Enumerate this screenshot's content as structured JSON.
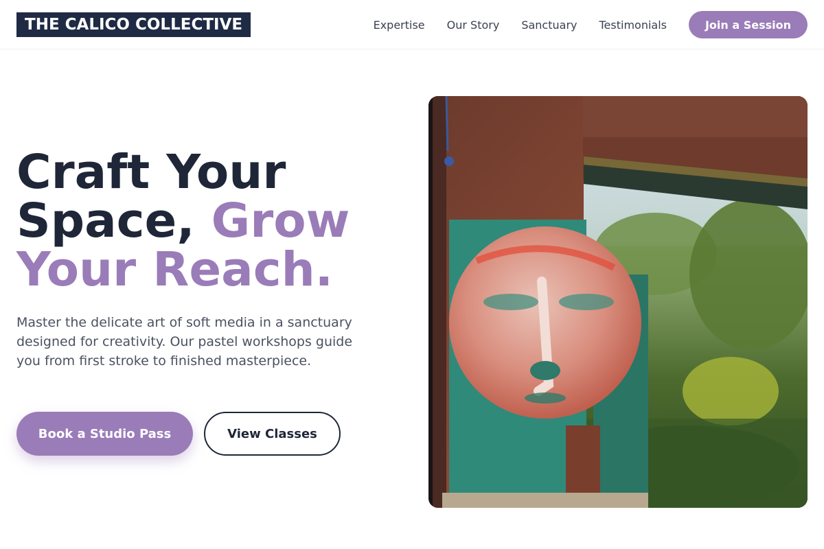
{
  "brand": {
    "logo_text": "THE CALICO COLLECTIVE"
  },
  "nav": {
    "links": [
      "Expertise",
      "Our Story",
      "Sanctuary",
      "Testimonials"
    ],
    "cta_label": "Join a Session"
  },
  "hero": {
    "title_part1": "Craft Your Space, ",
    "title_accent": "Grow Your Reach.",
    "description": "Master the delicate art of soft media in a sanctuary designed for creativity. Our pastel workshops guide you from first stroke to finished masterpiece.",
    "primary_button": "Book a Studio Pass",
    "secondary_button": "View Classes"
  },
  "colors": {
    "accent": "#9a7cb8",
    "dark": "#1f2a44",
    "text": "#1e2638",
    "muted": "#4a5160"
  },
  "image": {
    "subject": "painted-moon-face-panel-in-garden"
  }
}
